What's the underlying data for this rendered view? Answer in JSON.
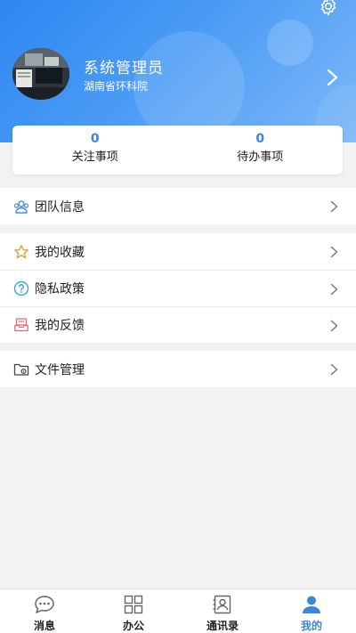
{
  "profile": {
    "name": "系统管理员",
    "org": "湖南省环科院"
  },
  "stats": [
    {
      "count": "0",
      "label": "关注事项"
    },
    {
      "count": "0",
      "label": "待办事项"
    }
  ],
  "menu": {
    "team": "团队信息",
    "favorites": "我的收藏",
    "privacy": "隐私政策",
    "feedback": "我的反馈",
    "files": "文件管理"
  },
  "tabs": [
    {
      "label": "消息",
      "icon": "chat-icon"
    },
    {
      "label": "办公",
      "icon": "grid-icon"
    },
    {
      "label": "通讯录",
      "icon": "contacts-icon"
    },
    {
      "label": "我的",
      "icon": "person-icon",
      "active": true
    }
  ],
  "colors": {
    "header_start": "#2e86f0",
    "header_end": "#7db8f8",
    "accent": "#3a86d8",
    "background": "#f2f2f2"
  }
}
